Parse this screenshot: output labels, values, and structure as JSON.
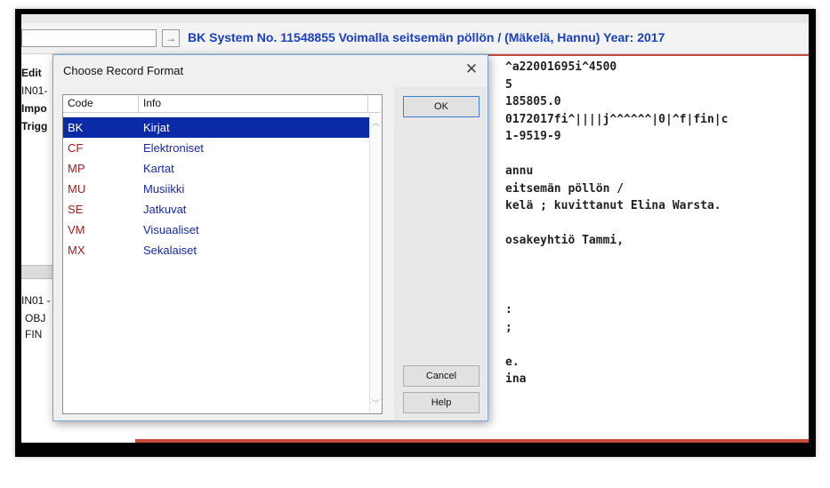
{
  "window": {
    "title": "BK System No. 11548855 Voimalla seitsemän pöllön / (Mäkelä, Hannu) Year: 2017",
    "go_glyph": "→"
  },
  "left_panel": {
    "items": [
      "Edit",
      "IN01-",
      "Impo",
      "Trigg"
    ],
    "tree": [
      "IN01 -",
      "OBJ",
      "FIN"
    ]
  },
  "editor": {
    "lines": [
      "^a22001695i^4500",
      "5",
      "185805.0",
      "0172017fi^||||j^^^^^^|0|^f|fin|c",
      "1-9519-9",
      "",
      "annu",
      "eitsemän pöllön /",
      "kelä ; kuvittanut Elina Warsta.",
      "",
      "osakeyhtiö Tammi,",
      "",
      "",
      "",
      ":",
      ";",
      "",
      "e.",
      "ina"
    ]
  },
  "dialog": {
    "title": "Choose Record Format",
    "close_glyph": "✕",
    "columns": {
      "code": "Code",
      "info": "Info"
    },
    "rows": [
      {
        "code": "BK",
        "info": "Kirjat",
        "selected": true
      },
      {
        "code": "CF",
        "info": "Elektroniset"
      },
      {
        "code": "MP",
        "info": "Kartat"
      },
      {
        "code": "MU",
        "info": "Musiikki"
      },
      {
        "code": "SE",
        "info": "Jatkuvat"
      },
      {
        "code": "VM",
        "info": "Visuaaliset"
      },
      {
        "code": "MX",
        "info": "Sekalaiset"
      }
    ],
    "buttons": {
      "ok": "OK",
      "cancel": "Cancel",
      "help": "Help"
    }
  },
  "colors": {
    "selection": "#0a2aa8",
    "code_text": "#a02020",
    "info_text": "#1a2a9f",
    "title_blue": "#1a3fbf",
    "editor_border": "#c74a40"
  }
}
